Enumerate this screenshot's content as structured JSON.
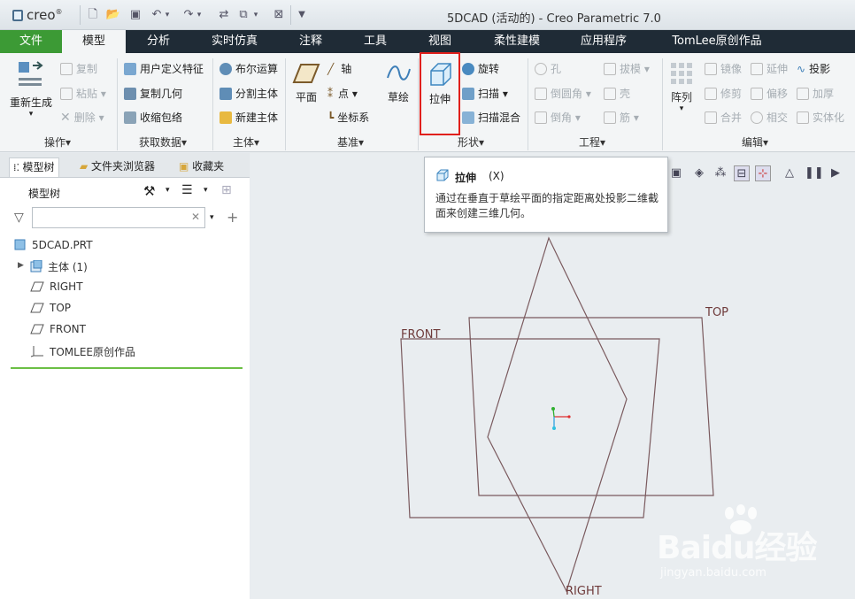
{
  "app": {
    "logo_text": "creo",
    "window_title": "5DCAD (活动的) - Creo Parametric 7.0"
  },
  "menu_tabs": [
    "文件",
    "模型",
    "分析",
    "实时仿真",
    "注释",
    "工具",
    "视图",
    "柔性建模",
    "应用程序",
    "TomLee原创作品"
  ],
  "ribbon": {
    "operations": {
      "regenerate": "重新生成",
      "copy": "复制",
      "paste": "粘贴",
      "delete": "删除",
      "group": "操作"
    },
    "get_data": {
      "udf": "用户定义特征",
      "copy_geom": "复制几何",
      "shrinkwrap": "收缩包络",
      "group": "获取数据"
    },
    "body": {
      "boolean": "布尔运算",
      "split": "分割主体",
      "new_body": "新建主体",
      "group": "主体"
    },
    "datum": {
      "plane": "平面",
      "axis": "轴",
      "point": "点",
      "csys": "坐标系",
      "sketch": "草绘",
      "group": "基准"
    },
    "shapes": {
      "extrude": "拉伸",
      "revolve": "旋转",
      "sweep": "扫描",
      "swept_blend": "扫描混合",
      "group": "形状"
    },
    "engineering": {
      "hole": "孔",
      "round": "倒圆角",
      "chamfer": "倒角",
      "draft": "拔模",
      "shell": "壳",
      "rib": "筋",
      "group": "工程"
    },
    "editing": {
      "pattern": "阵列",
      "mirror": "镜像",
      "extend": "延伸",
      "project": "投影",
      "trim": "修剪",
      "offset": "偏移",
      "thicken": "加厚",
      "merge": "合并",
      "intersect": "相交",
      "solidify": "实体化",
      "group": "编辑"
    }
  },
  "nav": {
    "tabs": [
      "模型树",
      "文件夹浏览器",
      "收藏夹"
    ],
    "header": "模型树",
    "filter_value": "",
    "tree": [
      {
        "label": "5DCAD.PRT",
        "icon": "part-icon"
      },
      {
        "label": "主体 (1)",
        "icon": "body-icon"
      },
      {
        "label": "RIGHT",
        "icon": "datum-plane-icon"
      },
      {
        "label": "TOP",
        "icon": "datum-plane-icon"
      },
      {
        "label": "FRONT",
        "icon": "datum-plane-icon"
      },
      {
        "label": "TOMLEE原创作品",
        "icon": "csys-icon"
      }
    ]
  },
  "graphics": {
    "plane_labels": {
      "front": "FRONT",
      "top": "TOP",
      "right": "RIGHT"
    }
  },
  "tooltip": {
    "title": "拉伸",
    "shortcut": "(X)",
    "description": "通过在垂直于草绘平面的指定距离处投影二维截面来创建三维几何。"
  },
  "watermark": {
    "brand": "Baidu经验",
    "url": "jingyan.baidu.com"
  },
  "colors": {
    "file_tab": "#3c9a35",
    "menu_bar": "#1f2b36",
    "highlight": "#e0201c",
    "datum": "#6e3a3a"
  }
}
